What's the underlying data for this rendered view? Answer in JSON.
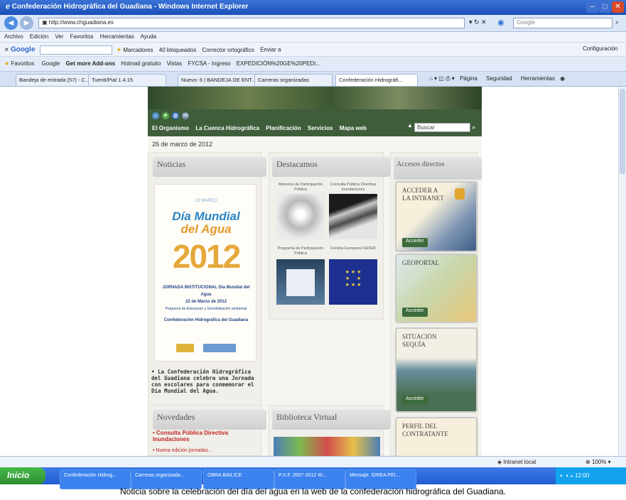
{
  "window": {
    "title": "Confederación Hidrográfica del Guadiana - Windows Internet Explorer",
    "address": "http://www.chguadiana.es",
    "search_placeholder": "Google"
  },
  "menu": [
    "Archivo",
    "Edición",
    "Ver",
    "Favoritos",
    "Herramientas",
    "Ayuda"
  ],
  "google_toolbar": {
    "label": "Google",
    "items": [
      "Marcadores",
      "40 bloqueados",
      "Corrector ortográfico",
      "Enviar a"
    ],
    "config": "Configuración"
  },
  "favorites": {
    "label": "Favoritos",
    "items": [
      "Google",
      "Get more Add-ons",
      "Hotmail gratuito",
      "Vistas",
      "FYCSA - Ingreso",
      "EXPEDICIÓN%20GE%20PEDI..."
    ]
  },
  "tabs": [
    "Bandeja de entrada (57) - C...",
    "Tuenti/Pial 1.4.15",
    "Nuevo: 6 | BANDEJA DE ENT...",
    "Carreras organizadas",
    "Confederación Hidrográfi..."
  ],
  "ie_tools": [
    "Página",
    "Seguridad",
    "Herramientas"
  ],
  "site": {
    "nav": [
      "El Organismo",
      "La Cuenca Hidrográfica",
      "Planificación",
      "Servicios",
      "Mapa web"
    ],
    "search_value": "Buscar",
    "date": "26 de marzo de 2012",
    "noticias": {
      "heading": "Noticias",
      "poster_top": "22 MARZO",
      "poster_title_1": "Día Mundial",
      "poster_title_2": "del Agua",
      "poster_year": "2012",
      "poster_lines": [
        "JORNADA INSTITUCIONAL Día Mundial del Agua",
        "22 de Marzo de 2012",
        "Programa de Educación y Sensibilización ambiental",
        "Confederación Hidrográfica del Guadiana"
      ],
      "news_text": "La Confederación Hidrográfica del Guadiana celebra una Jornada con escolares para conmemorar el Día Mundial del Agua."
    },
    "destacamos": {
      "heading": "Destacamos",
      "captions": [
        "Memoria de Participación Pública",
        "Consulta Pública Directiva Inundaciones",
        "Programa de Participación Pública",
        "Fondos Europeos FEDER"
      ]
    },
    "accesos": {
      "heading": "Accesos directos",
      "cards": [
        {
          "title": "ACCEDER A LA INTRANET",
          "button": "Acceder"
        },
        {
          "title": "GEOPORTAL",
          "button": "Acceder"
        },
        {
          "title": "SITUACIÓN SEQUÍA",
          "button": "Acceder"
        },
        {
          "title": "PERFIL DEL CONTRATANTE",
          "button": ""
        }
      ]
    },
    "novedades": {
      "heading": "Novedades",
      "items": [
        "Consulta Pública Directiva Inundaciones",
        "Nueva edición jornadas..."
      ]
    },
    "biblioteca": {
      "heading": "Biblioteca Virtual"
    }
  },
  "status": {
    "zone": "Intranet local",
    "zoom": "100%"
  },
  "taskbar": {
    "start": "Inicio",
    "tasks": [
      "Confederación Hidrog...",
      "Carreras organizada...",
      "OBRA BAILICE",
      "P.X.F. 2007-2012 W...",
      "Mensaje: IDREA PEI..."
    ],
    "time": "12:00"
  },
  "caption": "Noticia sobre la celebración del día del agua en la web de la confederación hidrográfica del Guadiana."
}
